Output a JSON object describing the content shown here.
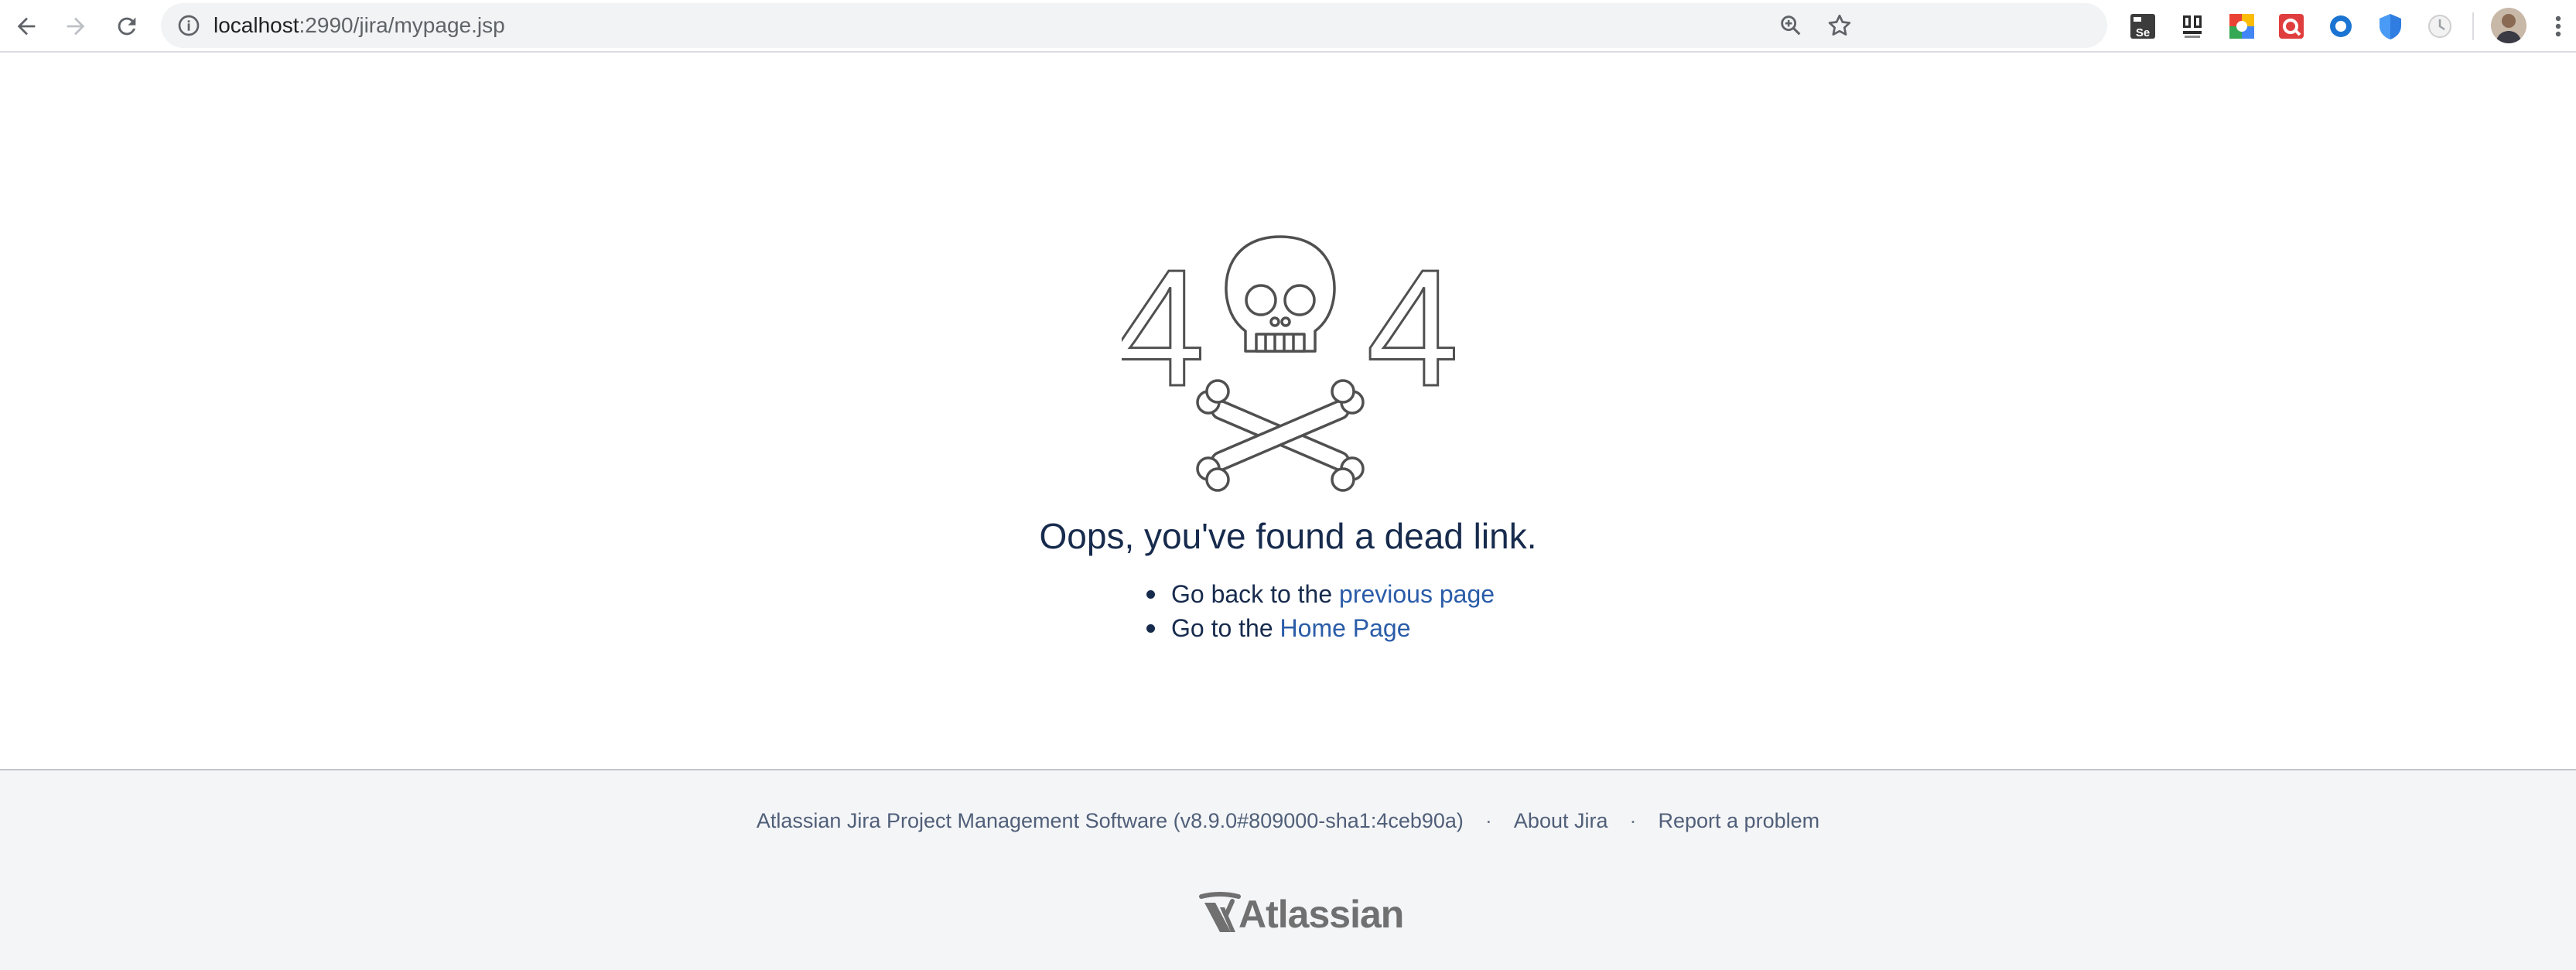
{
  "browser": {
    "url_host": "localhost",
    "url_path": ":2990/jira/mypage.jsp",
    "icons": {
      "back": "back-arrow-icon",
      "forward": "forward-arrow-icon",
      "reload": "reload-icon",
      "info": "info-icon",
      "zoom": "zoom-icon",
      "star": "bookmark-star-icon",
      "menu": "kebab-menu-icon"
    },
    "extensions": [
      {
        "name": "selenium-ide-extension-icon",
        "label": "Se"
      },
      {
        "name": "wappalyzer-extension-icon",
        "label": ""
      },
      {
        "name": "google-extension-icon",
        "label": ""
      },
      {
        "name": "red-extension-icon",
        "label": ""
      },
      {
        "name": "blue-ring-extension-icon",
        "label": ""
      },
      {
        "name": "blue-shield-extension-icon",
        "label": ""
      },
      {
        "name": "clock-extension-icon",
        "label": ""
      }
    ]
  },
  "error": {
    "code_left": "4",
    "code_right": "4",
    "headline": "Oops, you've found a dead link.",
    "options": [
      {
        "prefix": "Go back to the ",
        "link": "previous page"
      },
      {
        "prefix": "Go to the ",
        "link": "Home Page"
      }
    ]
  },
  "footer": {
    "software": "Atlassian Jira Project Management Software (v8.9.0#809000-sha1:4ceb90a)",
    "separator": "·",
    "about": "About Jira",
    "report": "Report a problem",
    "logo_text": "Atlassian"
  },
  "colors": {
    "link": "#2a5ca8",
    "text": "#172b4d",
    "footer_bg": "#f4f5f7",
    "illustration": "#505050"
  }
}
